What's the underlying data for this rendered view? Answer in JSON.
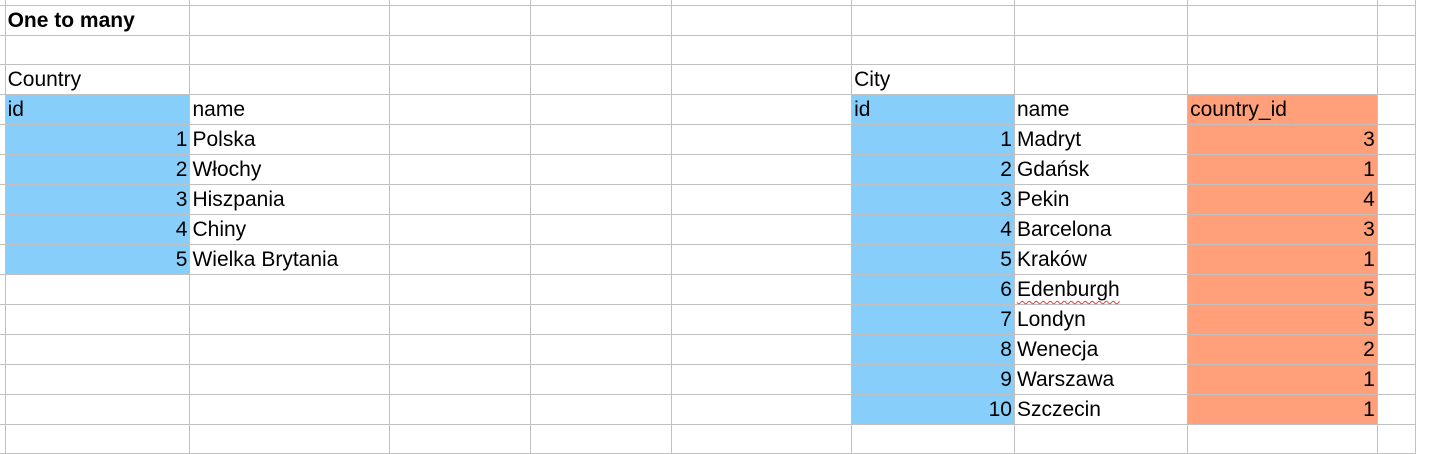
{
  "title": "One to many",
  "colors": {
    "id_fill": "#87cefa",
    "foreign_key_fill": "#ffa07a"
  },
  "country_table": {
    "label": "Country",
    "headers": [
      "id",
      "name"
    ],
    "rows": [
      {
        "id": "1",
        "name": "Polska"
      },
      {
        "id": "2",
        "name": "Włochy"
      },
      {
        "id": "3",
        "name": "Hiszpania"
      },
      {
        "id": "4",
        "name": "Chiny"
      },
      {
        "id": "5",
        "name": "Wielka Brytania"
      }
    ]
  },
  "city_table": {
    "label": "City",
    "headers": [
      "id",
      "name",
      "country_id"
    ],
    "rows": [
      {
        "id": "1",
        "name": "Madryt",
        "country_id": "3"
      },
      {
        "id": "2",
        "name": "Gdańsk",
        "country_id": "1"
      },
      {
        "id": "3",
        "name": "Pekin",
        "country_id": "4"
      },
      {
        "id": "4",
        "name": "Barcelona",
        "country_id": "3"
      },
      {
        "id": "5",
        "name": "Kraków",
        "country_id": "1"
      },
      {
        "id": "6",
        "name": "Edenburgh",
        "country_id": "5",
        "spellcheck_flag": true
      },
      {
        "id": "7",
        "name": "Londyn",
        "country_id": "5"
      },
      {
        "id": "8",
        "name": "Wenecja",
        "country_id": "2"
      },
      {
        "id": "9",
        "name": "Warszawa",
        "country_id": "1"
      },
      {
        "id": "10",
        "name": "Szczecin",
        "country_id": "1"
      }
    ]
  }
}
